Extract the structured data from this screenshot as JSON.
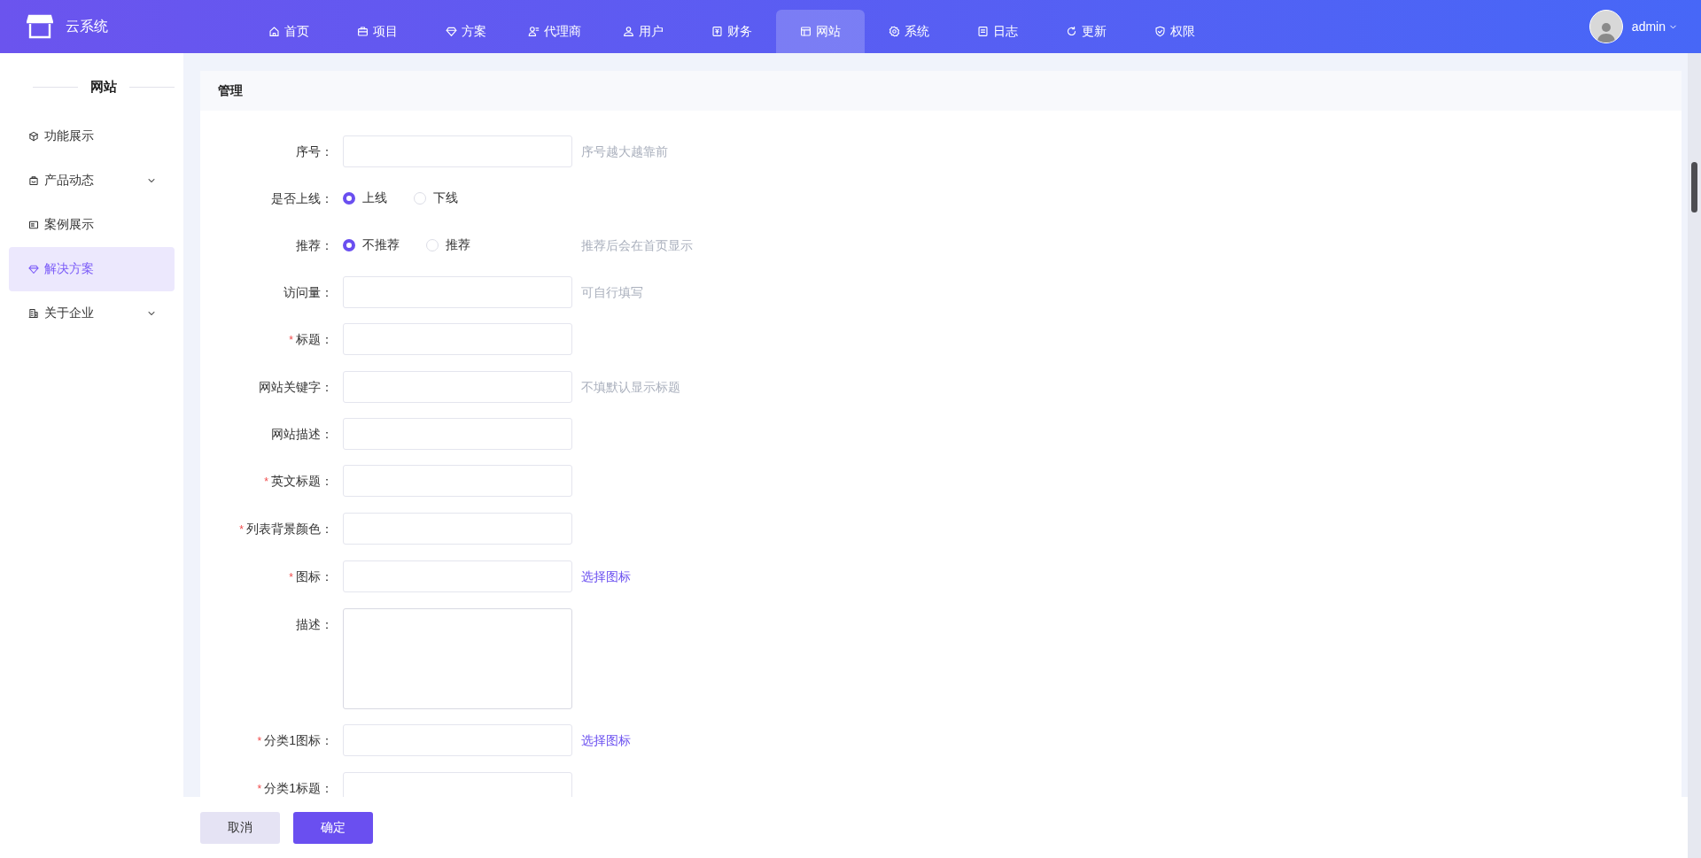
{
  "header": {
    "app_name": "云系统",
    "nav": [
      {
        "label": "首页",
        "selected": false
      },
      {
        "label": "项目",
        "selected": false
      },
      {
        "label": "方案",
        "selected": false
      },
      {
        "label": "代理商",
        "selected": false
      },
      {
        "label": "用户",
        "selected": false
      },
      {
        "label": "财务",
        "selected": false
      },
      {
        "label": "网站",
        "selected": true
      },
      {
        "label": "系统",
        "selected": false
      },
      {
        "label": "日志",
        "selected": false
      },
      {
        "label": "更新",
        "selected": false
      },
      {
        "label": "权限",
        "selected": false
      }
    ],
    "user": {
      "name": "admin"
    }
  },
  "sidebar": {
    "title": "网站",
    "items": [
      {
        "label": "功能展示",
        "selected": false,
        "expandable": false
      },
      {
        "label": "产品动态",
        "selected": false,
        "expandable": true
      },
      {
        "label": "案例展示",
        "selected": false,
        "expandable": false
      },
      {
        "label": "解决方案",
        "selected": true,
        "expandable": false
      },
      {
        "label": "关于企业",
        "selected": false,
        "expandable": true
      }
    ]
  },
  "panel": {
    "title": "管理",
    "fields": [
      {
        "kind": "input",
        "label": "序号：",
        "hint": "序号越大越靠前"
      },
      {
        "kind": "radio",
        "label": "是否上线：",
        "options": [
          {
            "label": "上线",
            "selected": true
          },
          {
            "label": "下线",
            "selected": false
          }
        ]
      },
      {
        "kind": "radio",
        "label": "推荐：",
        "options": [
          {
            "label": "不推荐",
            "selected": true
          },
          {
            "label": "推荐",
            "selected": false
          }
        ],
        "hint": "推荐后会在首页显示"
      },
      {
        "kind": "input",
        "label": "访问量：",
        "hint": "可自行填写"
      },
      {
        "kind": "input",
        "label": "标题：",
        "required_mark": "*"
      },
      {
        "kind": "input",
        "label": "网站关键字：",
        "hint": "不填默认显示标题"
      },
      {
        "kind": "input",
        "label": "网站描述："
      },
      {
        "kind": "input",
        "label": "英文标题：",
        "required_mark": "*"
      },
      {
        "kind": "input",
        "label": "列表背景颜色：",
        "required_mark": "*"
      },
      {
        "kind": "input",
        "label": "图标：",
        "required_mark": "*",
        "link": "选择图标"
      },
      {
        "kind": "textarea",
        "label": "描述："
      },
      {
        "kind": "input",
        "label": "分类1图标：",
        "required_mark": "*",
        "link": "选择图标"
      },
      {
        "kind": "input",
        "label": "分类1标题：",
        "required_mark": "*"
      }
    ]
  },
  "footer": {
    "buttons": [
      {
        "label": "取消",
        "kind": "secondary"
      },
      {
        "label": "确定",
        "kind": "primary"
      }
    ]
  }
}
